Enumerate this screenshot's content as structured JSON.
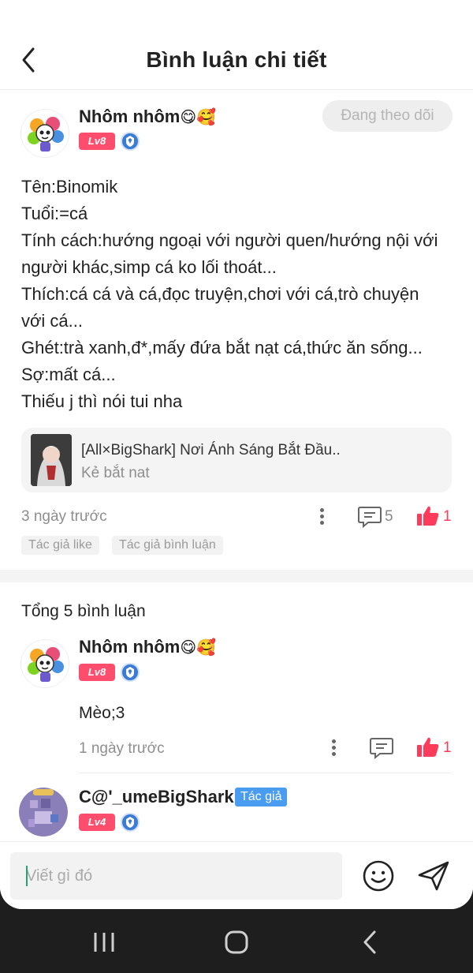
{
  "header": {
    "title": "Bình luận chi tiết"
  },
  "post": {
    "author": {
      "name": "Nhôm nhôm",
      "emoji": "😋🥰",
      "level": "Lv8"
    },
    "follow_label": "Đang theo dõi",
    "lines": [
      "Tên:Binomik",
      "Tuổi:=cá",
      "Tính cách:hướng ngoại với người quen/hướng nội với",
      "người khác,simp cá ko lối thoát...",
      "Thích:cá cá và cá,đọc truyện,chơi với cá,trò chuyện",
      "với cá...",
      "Ghét:trà xanh,đ*,mấy đứa bắt nạt cá,thức ăn sống...",
      "Sợ:mất cá...",
      "Thiếu j thì nói tui nha"
    ],
    "link": {
      "title": "[All×BigShark] Nơi Ánh Sáng Bắt Đầu..",
      "subtitle": "Kẻ bắt nat"
    },
    "time": "3 ngày trước",
    "comment_count": "5",
    "like_count": "1",
    "tags": [
      "Tác giả like",
      "Tác giả bình luận"
    ]
  },
  "comments": {
    "title": "Tổng 5 bình luận",
    "items": [
      {
        "name": "Nhôm nhôm",
        "emoji": "😋🥰",
        "level": "Lv8",
        "text": "Mèo;3",
        "time": "1 ngày trước",
        "like_count": "1"
      },
      {
        "name": "C@'_umeBigShark",
        "author_tag": "Tác giả",
        "level": "Lv4"
      }
    ]
  },
  "composer": {
    "placeholder": "Viết gì đó"
  },
  "colors": {
    "accent": "#ff3b5c",
    "level_badge": "#ff4d6d",
    "author_tag": "#4a9cf0",
    "cursor": "#1fa37a"
  }
}
